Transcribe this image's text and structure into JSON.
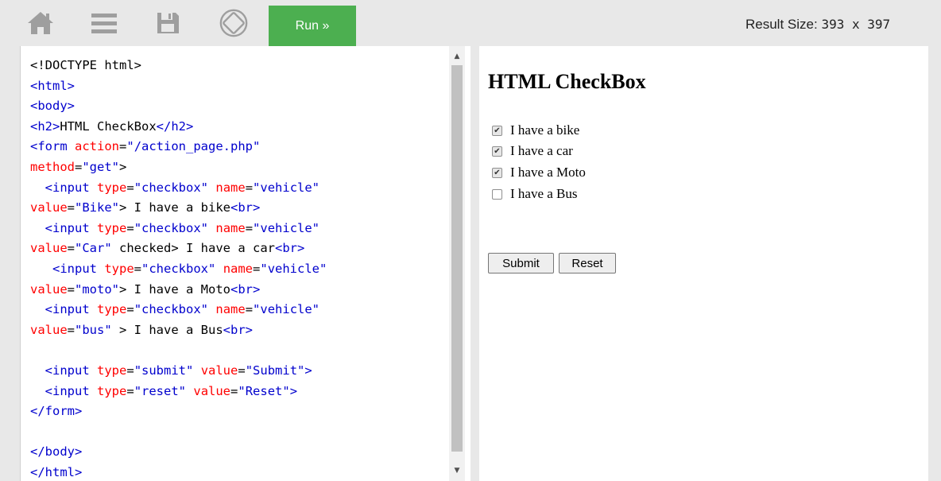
{
  "toolbar": {
    "icons": [
      "home-icon",
      "menu-icon",
      "save-icon",
      "rotate-icon"
    ],
    "run_label": "Run »",
    "result_size_label": "Result Size:",
    "result_size_value": "393 x 397"
  },
  "code": {
    "lines": [
      [
        "<!DOCTYPE html>"
      ],
      [
        "<html>"
      ],
      [
        "<body>"
      ],
      [
        "<h2>HTML CheckBox</h2>"
      ],
      [
        "<form action=\"/action_page.php\""
      ],
      [
        "method=\"get\">"
      ],
      [
        "  <input type=\"checkbox\" name=\"vehicle\""
      ],
      [
        "value=\"Bike\"> I have a bike<br>"
      ],
      [
        "  <input type=\"checkbox\" name=\"vehicle\""
      ],
      [
        "value=\"Car\" checked> I have a car<br>"
      ],
      [
        "   <input type=\"checkbox\" name=\"vehicle\""
      ],
      [
        "value=\"moto\"> I have a Moto<br>"
      ],
      [
        "  <input type=\"checkbox\" name=\"vehicle\""
      ],
      [
        "value=\"bus\" > I have a Bus<br>"
      ],
      [
        ""
      ],
      [
        "  <input type=\"submit\" value=\"Submit\">"
      ],
      [
        "  <input type=\"reset\" value=\"Reset\">"
      ],
      [
        "</form>"
      ],
      [
        ""
      ],
      [
        "</body>"
      ],
      [
        "</html>"
      ]
    ]
  },
  "result": {
    "heading": "HTML CheckBox",
    "checkboxes": [
      {
        "label": "I have a bike",
        "checked": true
      },
      {
        "label": "I have a car",
        "checked": true
      },
      {
        "label": "I have a Moto",
        "checked": true
      },
      {
        "label": "I have a Bus",
        "checked": false
      }
    ],
    "submit_label": "Submit",
    "reset_label": "Reset"
  }
}
